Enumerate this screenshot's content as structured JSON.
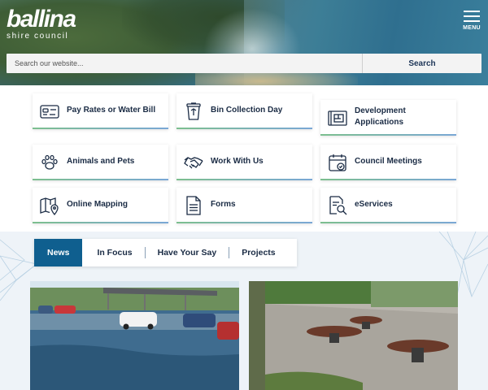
{
  "header": {
    "logo_main": "ballina",
    "logo_sub": "shire council",
    "menu_label": "MENU"
  },
  "search": {
    "placeholder": "Search our website...",
    "button_label": "Search"
  },
  "quick_links": [
    {
      "label": "Pay Rates or Water Bill",
      "icon": "card-icon"
    },
    {
      "label": "Bin Collection Day",
      "icon": "bin-icon"
    },
    {
      "label": "Development Applications",
      "icon": "blueprint-icon"
    },
    {
      "label": "Animals and Pets",
      "icon": "paw-icon"
    },
    {
      "label": "Work With Us",
      "icon": "handshake-icon"
    },
    {
      "label": "Council Meetings",
      "icon": "calendar-icon"
    },
    {
      "label": "Online Mapping",
      "icon": "map-icon"
    },
    {
      "label": "Forms",
      "icon": "document-icon"
    },
    {
      "label": "eServices",
      "icon": "search-document-icon"
    }
  ],
  "tabs": [
    {
      "label": "News",
      "active": true
    },
    {
      "label": "In Focus",
      "active": false
    },
    {
      "label": "Have Your Say",
      "active": false
    },
    {
      "label": "Projects",
      "active": false
    }
  ],
  "colors": {
    "brand_navy": "#1a2b44",
    "tab_active": "#0f5f8f",
    "tile_underline_start": "#7cbf8e",
    "tile_underline_end": "#7aa7d6"
  }
}
